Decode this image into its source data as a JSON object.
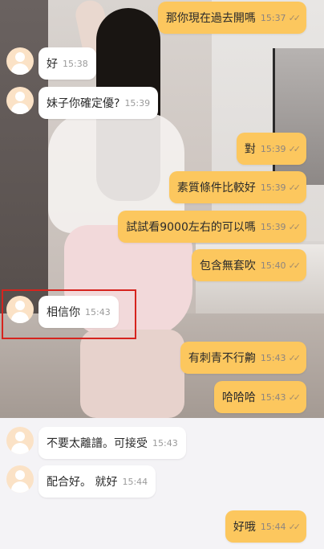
{
  "messages": [
    {
      "dir": "out",
      "text": "那你現在過去開嗎",
      "time": "15:37",
      "read": true
    },
    {
      "dir": "in",
      "text": "好",
      "time": "15:38"
    },
    {
      "dir": "in",
      "text": "妹子你確定優?",
      "time": "15:39"
    },
    {
      "dir": "out",
      "text": "對",
      "time": "15:39",
      "read": true
    },
    {
      "dir": "out",
      "text": "素質條件比較好",
      "time": "15:39",
      "read": true
    },
    {
      "dir": "out",
      "text": "試試看9000左右的可以嗎",
      "time": "15:39",
      "read": true
    },
    {
      "dir": "out",
      "text": "包含無套吹",
      "time": "15:40",
      "read": true
    },
    {
      "dir": "in",
      "text": "相信你",
      "time": "15:43",
      "highlighted": true
    },
    {
      "dir": "out",
      "text": "有刺青不行齁",
      "time": "15:43",
      "read": true
    },
    {
      "dir": "out",
      "text": "哈哈哈",
      "time": "15:43",
      "read": true
    },
    {
      "dir": "in",
      "text": "不要太離譜。可接受",
      "time": "15:43"
    },
    {
      "dir": "in",
      "text": "配合好。 就好",
      "time": "15:44"
    },
    {
      "dir": "out",
      "text": "好哦",
      "time": "15:44",
      "read": true
    }
  ],
  "colors": {
    "outgoing_bubble": "#fcc75e",
    "incoming_bubble": "#ffffff",
    "highlight_box": "#d6241e",
    "avatar": "#fbe2c6"
  },
  "icons": {
    "read_receipt": "double-check-icon",
    "avatar": "default-user-avatar-icon"
  }
}
